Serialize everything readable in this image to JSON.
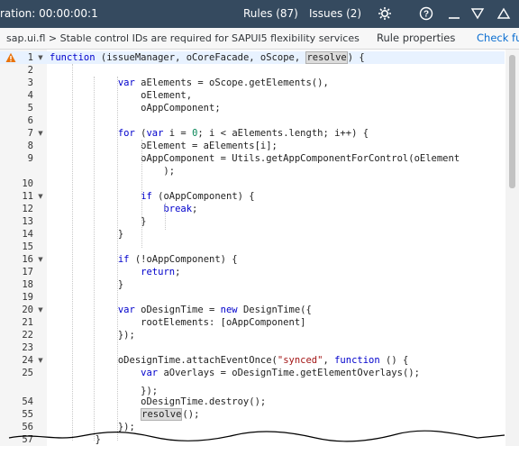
{
  "titlebar": {
    "duration_text": "ration: 00:00:00:1",
    "rules_tab": "Rules (87)",
    "issues_tab": "Issues (2)",
    "icons": [
      "gear-icon",
      "help-icon",
      "minimize-icon",
      "collapse-icon",
      "expand-icon"
    ]
  },
  "tabbar": {
    "breadcrumb": "sap.ui.fl > Stable control IDs are required for SAPUI5 flexibility services",
    "rule_properties": "Rule properties",
    "check_fix": "Check fu"
  },
  "editor": {
    "warning_line": "1",
    "lines": [
      {
        "n": "1",
        "fold": true,
        "warn": true,
        "code": "function (issueManager, oCoreFacade, oScope, resolve) {"
      },
      {
        "n": "2",
        "fold": false,
        "code": ""
      },
      {
        "n": "3",
        "fold": false,
        "code": "            var aElements = oScope.getElements(),"
      },
      {
        "n": "4",
        "fold": false,
        "code": "                oElement,"
      },
      {
        "n": "5",
        "fold": false,
        "code": "                oAppComponent;"
      },
      {
        "n": "6",
        "fold": false,
        "code": ""
      },
      {
        "n": "7",
        "fold": true,
        "code": "            for (var i = 0; i < aElements.length; i++) {"
      },
      {
        "n": "8",
        "fold": false,
        "code": "                oElement = aElements[i];"
      },
      {
        "n": "9",
        "fold": false,
        "code": "                oAppComponent = Utils.getAppComponentForControl(oElement"
      },
      {
        "n": "",
        "fold": false,
        "code": "                    );"
      },
      {
        "n": "10",
        "fold": false,
        "code": ""
      },
      {
        "n": "11",
        "fold": true,
        "code": "                if (oAppComponent) {"
      },
      {
        "n": "12",
        "fold": false,
        "code": "                    break;"
      },
      {
        "n": "13",
        "fold": false,
        "code": "                }"
      },
      {
        "n": "14",
        "fold": false,
        "code": "            }"
      },
      {
        "n": "15",
        "fold": false,
        "code": ""
      },
      {
        "n": "16",
        "fold": true,
        "code": "            if (!oAppComponent) {"
      },
      {
        "n": "17",
        "fold": false,
        "code": "                return;"
      },
      {
        "n": "18",
        "fold": false,
        "code": "            }"
      },
      {
        "n": "19",
        "fold": false,
        "code": ""
      },
      {
        "n": "20",
        "fold": true,
        "code": "            var oDesignTime = new DesignTime({"
      },
      {
        "n": "21",
        "fold": false,
        "code": "                rootElements: [oAppComponent]"
      },
      {
        "n": "22",
        "fold": false,
        "code": "            });"
      },
      {
        "n": "23",
        "fold": false,
        "code": ""
      },
      {
        "n": "24",
        "fold": true,
        "code": "            oDesignTime.attachEventOnce(\"synced\", function () {"
      },
      {
        "n": "25",
        "fold": false,
        "code": "                var aOverlays = oDesignTime.getElementOverlays();"
      },
      {
        "n": "",
        "fold": false,
        "code": "                });"
      },
      {
        "n": "54",
        "fold": false,
        "code": "                oDesignTime.destroy();"
      },
      {
        "n": "55",
        "fold": false,
        "code": "                resolve();"
      },
      {
        "n": "56",
        "fold": false,
        "code": "            });"
      },
      {
        "n": "57",
        "fold": false,
        "code": "        }"
      }
    ]
  },
  "colors": {
    "titlebar_bg": "#354a5f",
    "keyword": "#0000cc",
    "string": "#a31515",
    "number": "#098658",
    "link": "#0a6ed1",
    "warning": "#e9730c"
  }
}
